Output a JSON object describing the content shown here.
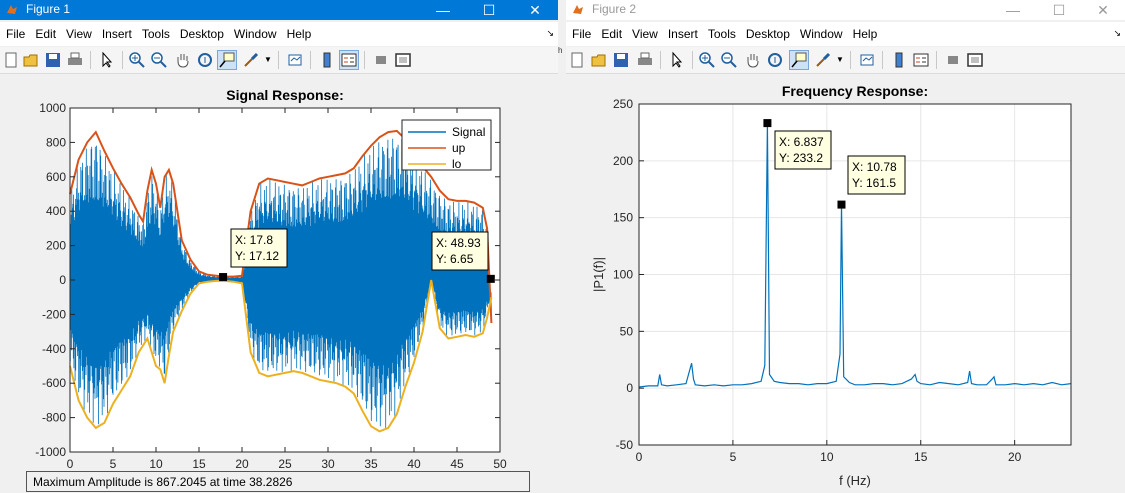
{
  "figure1": {
    "title": "Figure 1",
    "menu": [
      "File",
      "Edit",
      "View",
      "Insert",
      "Tools",
      "Desktop",
      "Window",
      "Help"
    ],
    "status_text": "Maximum Amplitude is 867.2045 at time 38.2826",
    "chart_data": {
      "type": "line",
      "title": "Signal Response:",
      "xlabel": "",
      "ylabel": "",
      "xlim": [
        0,
        50
      ],
      "ylim": [
        -1000,
        1000
      ],
      "xticks": [
        0,
        5,
        10,
        15,
        20,
        25,
        30,
        35,
        40,
        45,
        50
      ],
      "yticks": [
        -1000,
        -800,
        -600,
        -400,
        -200,
        0,
        200,
        400,
        600,
        800,
        1000
      ],
      "grid": false,
      "legend_position": "top-right",
      "series": [
        {
          "name": "Signal",
          "color": "#0072bd",
          "description": "dense oscillation bounded by up/lo envelopes"
        },
        {
          "name": "up",
          "color": "#d95319",
          "x": [
            0,
            1,
            2,
            3,
            4,
            5,
            6,
            7,
            8,
            8.5,
            9,
            9.5,
            10,
            10.5,
            11,
            11.5,
            12,
            13,
            14,
            15,
            16,
            17,
            18,
            19,
            20,
            21,
            22,
            23,
            24,
            25,
            26,
            27,
            28,
            29,
            30,
            31,
            32,
            33,
            34,
            35,
            36,
            37,
            38,
            39,
            40,
            41,
            42,
            43,
            44,
            45,
            46,
            47,
            48,
            48.5,
            49
          ],
          "y": [
            500,
            700,
            800,
            860,
            750,
            650,
            560,
            480,
            380,
            340,
            520,
            640,
            560,
            420,
            600,
            640,
            560,
            230,
            120,
            50,
            30,
            25,
            20,
            20,
            25,
            400,
            560,
            590,
            580,
            570,
            560,
            550,
            570,
            590,
            600,
            610,
            620,
            650,
            720,
            780,
            830,
            860,
            867,
            820,
            730,
            660,
            600,
            520,
            470,
            460,
            460,
            450,
            420,
            300,
            -250
          ]
        },
        {
          "name": "lo",
          "color": "#edb120",
          "x": [
            0,
            1,
            2,
            3,
            4,
            5,
            6,
            7,
            8,
            8.5,
            9,
            9.5,
            10,
            10.5,
            11,
            11.5,
            12,
            13,
            14,
            15,
            16,
            17,
            18,
            19,
            20,
            21,
            22,
            23,
            24,
            25,
            26,
            27,
            28,
            29,
            30,
            31,
            32,
            33,
            34,
            35,
            36,
            37,
            38,
            39,
            40,
            41,
            42,
            43,
            44,
            45,
            46,
            47,
            48,
            48.5,
            49
          ],
          "y": [
            -500,
            -700,
            -800,
            -860,
            -830,
            -720,
            -640,
            -560,
            -420,
            -380,
            -340,
            -420,
            -500,
            -520,
            -600,
            -440,
            -300,
            -180,
            -80,
            -20,
            -10,
            -5,
            -5,
            -10,
            -20,
            -420,
            -540,
            -560,
            -550,
            -540,
            -530,
            -540,
            -560,
            -580,
            -590,
            -600,
            -620,
            -660,
            -760,
            -850,
            -880,
            -860,
            -780,
            -620,
            -480,
            -300,
            0,
            -280,
            -340,
            -330,
            -320,
            -330,
            -310,
            -220,
            -100
          ]
        }
      ],
      "annotations": [
        {
          "x": 17.8,
          "y": 17.12,
          "label_x": "X: 17.8",
          "label_y": "Y: 17.12"
        },
        {
          "x": 48.93,
          "y": 6.65,
          "label_x": "X: 48.93",
          "label_y": "Y: 6.65"
        }
      ]
    }
  },
  "figure2": {
    "title": "Figure 2",
    "menu": [
      "File",
      "Edit",
      "View",
      "Insert",
      "Tools",
      "Desktop",
      "Window",
      "Help"
    ],
    "chart_data": {
      "type": "line",
      "title": "Frequency Response:",
      "xlabel": "f (Hz)",
      "ylabel": "|P1(f)|",
      "xlim": [
        0,
        23
      ],
      "ylim": [
        -50,
        250
      ],
      "xticks": [
        0,
        5,
        10,
        15,
        20
      ],
      "yticks": [
        -50,
        0,
        50,
        100,
        150,
        200,
        250
      ],
      "grid": true,
      "series": [
        {
          "name": "",
          "color": "#0072bd",
          "x": [
            0,
            0.5,
            1.0,
            1.1,
            1.2,
            1.5,
            2.0,
            2.5,
            2.8,
            2.9,
            3.0,
            3.5,
            4.0,
            4.5,
            5.0,
            5.5,
            6.0,
            6.5,
            6.7,
            6.837,
            6.95,
            7.2,
            7.5,
            8,
            8.5,
            9,
            9.5,
            10,
            10.5,
            10.7,
            10.78,
            10.9,
            11.2,
            11.5,
            12,
            12.5,
            13,
            13.5,
            14,
            14.5,
            14.7,
            14.8,
            15,
            15.5,
            16,
            16.5,
            17,
            17.5,
            17.6,
            17.7,
            18,
            18.5,
            18.8,
            18.9,
            19,
            19.5,
            20,
            20.5,
            21,
            21.5,
            22,
            22.5,
            23
          ],
          "y": [
            1,
            2,
            2,
            12,
            3,
            2,
            3,
            4,
            22,
            8,
            3,
            2,
            3,
            2,
            3,
            3,
            4,
            6,
            20,
            233.2,
            12,
            6,
            5,
            4,
            4,
            3,
            4,
            4,
            6,
            30,
            161.5,
            10,
            5,
            3,
            3,
            4,
            4,
            3,
            4,
            8,
            12,
            6,
            4,
            3,
            5,
            4,
            3,
            5,
            15,
            4,
            3,
            3,
            8,
            10,
            3,
            3,
            4,
            3,
            4,
            3,
            5,
            3,
            4
          ]
        }
      ],
      "annotations": [
        {
          "x": 6.837,
          "y": 233.2,
          "label_x": "X: 6.837",
          "label_y": "Y: 233.2"
        },
        {
          "x": 10.78,
          "y": 161.5,
          "label_x": "X: 10.78",
          "label_y": "Y: 161.5"
        }
      ]
    }
  }
}
